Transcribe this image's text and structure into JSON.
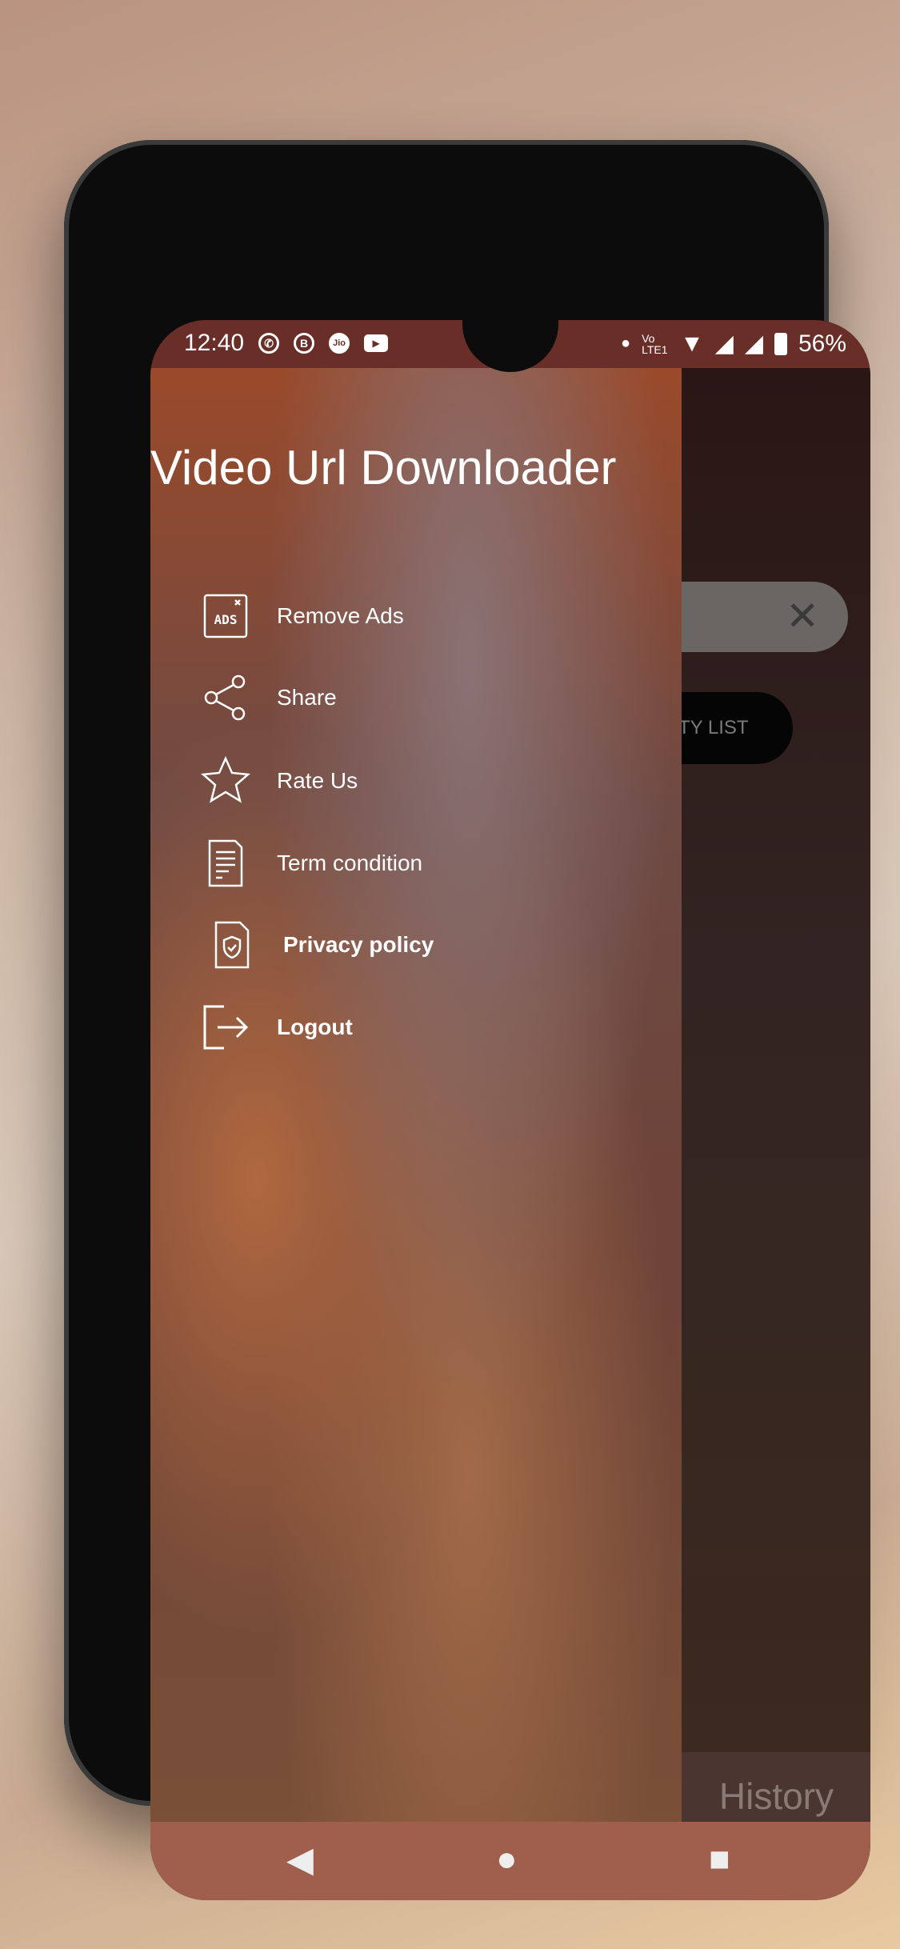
{
  "status_bar": {
    "time": "12:40",
    "notification_icons": [
      "whatsapp-icon",
      "whatsapp-business-icon",
      "jio-icon",
      "youtube-icon"
    ],
    "network": "Vo LTE1",
    "battery": "56%"
  },
  "main": {
    "search_clear_icon": "close-icon",
    "button_label": "TY LIST",
    "history_label": "History"
  },
  "drawer": {
    "title": "Video Url Downloader",
    "items": [
      {
        "label": "Remove Ads",
        "icon": "remove-ads-icon"
      },
      {
        "label": "Share",
        "icon": "share-icon"
      },
      {
        "label": "Rate Us",
        "icon": "star-icon"
      },
      {
        "label": "Term condition",
        "icon": "document-icon"
      },
      {
        "label": "Privacy policy",
        "icon": "privacy-shield-icon"
      },
      {
        "label": "Logout",
        "icon": "logout-icon"
      }
    ]
  }
}
